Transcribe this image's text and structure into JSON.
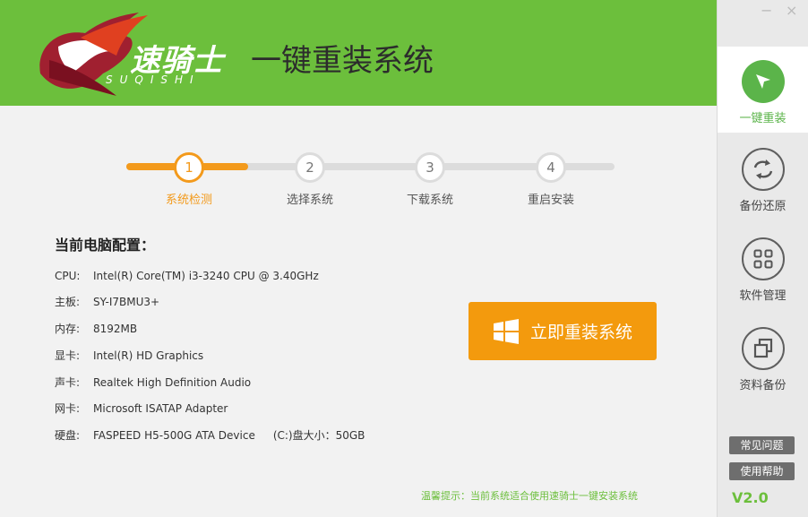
{
  "header": {
    "logo_cn": "速骑士",
    "logo_en": "SUQISHI",
    "title": "一键重装系统",
    "brand_color": "#6cbf3c"
  },
  "steps": [
    {
      "num": "1",
      "label": "系统检测",
      "active": true
    },
    {
      "num": "2",
      "label": "选择系统",
      "active": false
    },
    {
      "num": "3",
      "label": "下载系统",
      "active": false
    },
    {
      "num": "4",
      "label": "重启安装",
      "active": false
    }
  ],
  "specs": {
    "title": "当前电脑配置：",
    "items": [
      {
        "key": "CPU:",
        "value": "Intel(R) Core(TM) i3-3240 CPU @ 3.40GHz"
      },
      {
        "key": "主板:",
        "value": "SY-I7BMU3+"
      },
      {
        "key": "内存:",
        "value": "8192MB"
      },
      {
        "key": "显卡:",
        "value": "Intel(R) HD Graphics"
      },
      {
        "key": "声卡:",
        "value": "Realtek High Definition Audio"
      },
      {
        "key": "网卡:",
        "value": "Microsoft ISATAP Adapter"
      },
      {
        "key": "硬盘:",
        "value": "FASPEED H5-500G ATA Device",
        "extra": "(C:)盘大小：50GB"
      }
    ]
  },
  "install_button": {
    "label": "立即重装系统",
    "icon": "windows-icon",
    "color": "#f39a0d"
  },
  "hint": "温馨提示：当前系统适合使用速骑士一键安装系统",
  "window": {
    "minimize": "−",
    "close": "×"
  },
  "sidebar": {
    "items": [
      {
        "label": "一键重装",
        "icon": "cursor-arrow-icon",
        "active": true
      },
      {
        "label": "备份还原",
        "icon": "refresh-icon",
        "active": false
      },
      {
        "label": "软件管理",
        "icon": "grid-icon",
        "active": false
      },
      {
        "label": "资料备份",
        "icon": "copy-icon",
        "active": false
      }
    ],
    "faq": "常见问题",
    "help": "使用帮助",
    "version": "V2.0"
  }
}
